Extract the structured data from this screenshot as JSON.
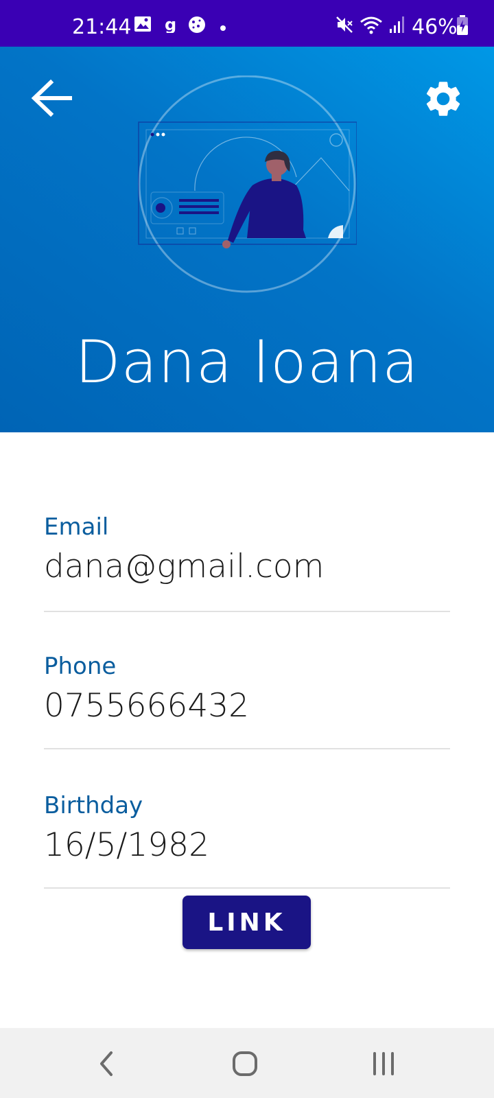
{
  "status_bar": {
    "time": "21:44",
    "battery": "46%",
    "icons": [
      "image-icon",
      "g-app-icon",
      "cookie-icon",
      "dot-icon",
      "mute-icon",
      "wifi-icon",
      "signal-icon",
      "battery-icon"
    ]
  },
  "header": {
    "name": "Dana Ioana",
    "icons": [
      "back-arrow-icon",
      "gear-icon"
    ],
    "background_colors": [
      "#0098e6",
      "#0064b5"
    ]
  },
  "fields": [
    {
      "label": "Email",
      "value": "dana@gmail.com"
    },
    {
      "label": "Phone",
      "value": "0755666432"
    },
    {
      "label": "Birthday",
      "value": "16/5/1982"
    }
  ],
  "link_button": {
    "label": "LINK",
    "color": "#1a1485"
  },
  "nav_bar": {
    "icons": [
      "nav-back-icon",
      "nav-home-icon",
      "nav-recents-icon"
    ]
  },
  "colors": {
    "status_bar": "#3a00b4",
    "label": "#0a5d9e"
  }
}
